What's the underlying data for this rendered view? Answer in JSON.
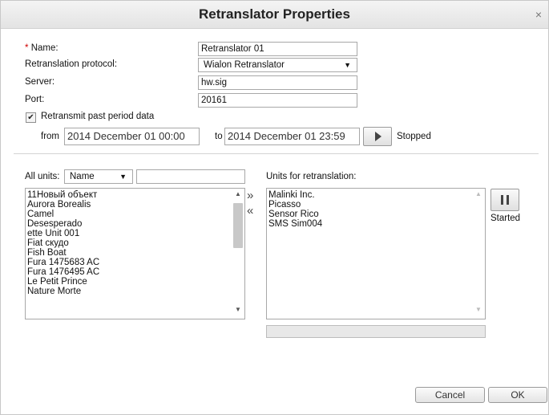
{
  "dialog": {
    "title": "Retranslator Properties",
    "close_glyph": "×"
  },
  "form": {
    "name_required_mark": "*",
    "name_label": "Name:",
    "name_value": "Retranslator 01",
    "protocol_label": "Retranslation protocol:",
    "protocol_value": "Wialon Retranslator",
    "server_label": "Server:",
    "server_value": "hw.sig",
    "port_label": "Port:",
    "port_value": "20161",
    "retransmit_label": "Retransmit past period data",
    "retransmit_checked": true,
    "check_glyph": "✔",
    "from_label": "from",
    "from_value": "2014 December 01 00:00",
    "to_label": "to",
    "to_value": "2014 December 01 23:59",
    "period_status": "Stopped"
  },
  "units": {
    "all_units_label": "All units:",
    "filter_field": "Name",
    "filter_arrow": "▼",
    "search_value": "",
    "all_units": [
      "11Новый объект",
      "Aurora Borealis",
      "Camel",
      "Desesperado",
      "ette Unit 001",
      "Fiat скудо",
      "Fish Boat",
      "Fura 1475683 AC",
      "Fura 1476495 AC",
      "Le Petit Prince",
      "Nature Morte"
    ],
    "add_glyph": "»",
    "remove_glyph": "«",
    "retranslation_label": "Units for retranslation:",
    "retranslation_units": [
      "Malinki Inc.",
      "Picasso",
      "Sensor Rico",
      "SMS Sim004"
    ],
    "scroll_up_glyph": "▲",
    "scroll_down_glyph": "▼",
    "retranslator_status": "Started"
  },
  "footer": {
    "cancel_label": "Cancel",
    "ok_label": "OK"
  }
}
